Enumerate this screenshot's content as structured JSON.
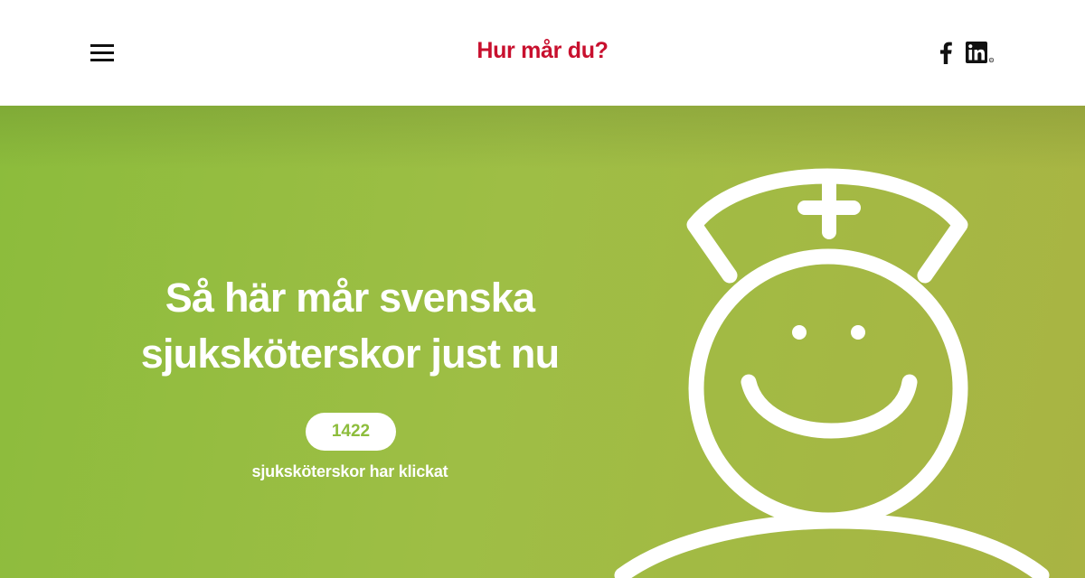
{
  "header": {
    "title": "Hur mår du?",
    "title_color": "#c8102e",
    "menu_icon": "hamburger-menu-icon",
    "social": [
      {
        "name": "facebook",
        "icon": "facebook-icon"
      },
      {
        "name": "linkedin",
        "icon": "linkedin-icon"
      }
    ]
  },
  "hero": {
    "headline_line1": "Så här mår svenska",
    "headline_line2": "sjuksköterskor just nu",
    "count": "1422",
    "count_caption": "sjuksköterskor har klickat",
    "accent_color": "#8dbd3c",
    "gradient": [
      "#8cbc3c",
      "#9ebe45",
      "#a9b443"
    ],
    "illustration_icon": "smiling-nurse-icon"
  }
}
